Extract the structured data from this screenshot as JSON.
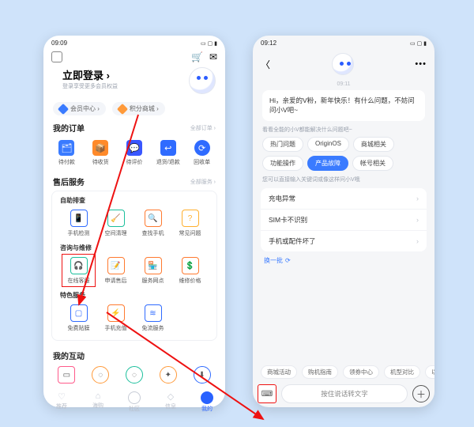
{
  "p1": {
    "time": "09:09",
    "login_title": "立即登录 ›",
    "login_sub": "登录享受更多会员权益",
    "pill_member": "会员中心 ›",
    "pill_points": "积分商城 ›",
    "orders": {
      "title": "我的订单",
      "link": "全部订单 ›",
      "items": [
        {
          "l": "待付款",
          "c": "#3a7bff"
        },
        {
          "l": "待收货",
          "c": "#ff8a2a"
        },
        {
          "l": "待评价",
          "c": "#3957ff"
        },
        {
          "l": "退货/退款",
          "c": "#2f6bff"
        },
        {
          "l": "回收单",
          "c": "#2f6bff"
        }
      ]
    },
    "after": {
      "title": "售后服务",
      "link": "全部服务 ›",
      "g1": {
        "title": "自助排查",
        "items": [
          {
            "l": "手机检测",
            "c": "#2f6bff"
          },
          {
            "l": "空间清理",
            "c": "#1bbf9c"
          },
          {
            "l": "查找手机",
            "c": "#ff7a2f"
          },
          {
            "l": "常见问题",
            "c": "#ffb02e"
          }
        ]
      },
      "g2": {
        "title": "咨询与维修",
        "items": [
          {
            "l": "在线客服",
            "c": "#1bbf9c"
          },
          {
            "l": "申请售后",
            "c": "#ff7a2f"
          },
          {
            "l": "服务网点",
            "c": "#ff7a2f"
          },
          {
            "l": "维修价格",
            "c": "#ff7a2f"
          }
        ]
      },
      "g3": {
        "title": "特色服务",
        "items": [
          {
            "l": "免费贴膜",
            "c": "#2f6bff"
          },
          {
            "l": "手机充值",
            "c": "#ff7a2f"
          },
          {
            "l": "免流服务",
            "c": "#2f6bff"
          }
        ]
      }
    },
    "inter": "我的互动",
    "tabs": [
      "推荐",
      "海购",
      "社区",
      "信息",
      "我的"
    ]
  },
  "p2": {
    "time": "09:12",
    "ts": "09:11",
    "greet": "Hi，亲爱的V粉，新年快乐！有什么问题，不妨问问小V吧~",
    "hint1": "看看全能的小V都能解决什么问题吧~",
    "chips": [
      "热门问题",
      "OriginOS",
      "商城相关",
      "功能操作",
      "产品故障",
      "帐号相关"
    ],
    "hint2": "您可以直接输入关键词或像这样问小V哦",
    "faq": [
      "充电异常",
      "SIM卡不识别",
      "手机或配件坏了"
    ],
    "rotate": "换一批",
    "tags": [
      "商城活动",
      "购机指南",
      "领券中心",
      "机型对比",
      "以"
    ],
    "voice": "按住说话转文字"
  }
}
